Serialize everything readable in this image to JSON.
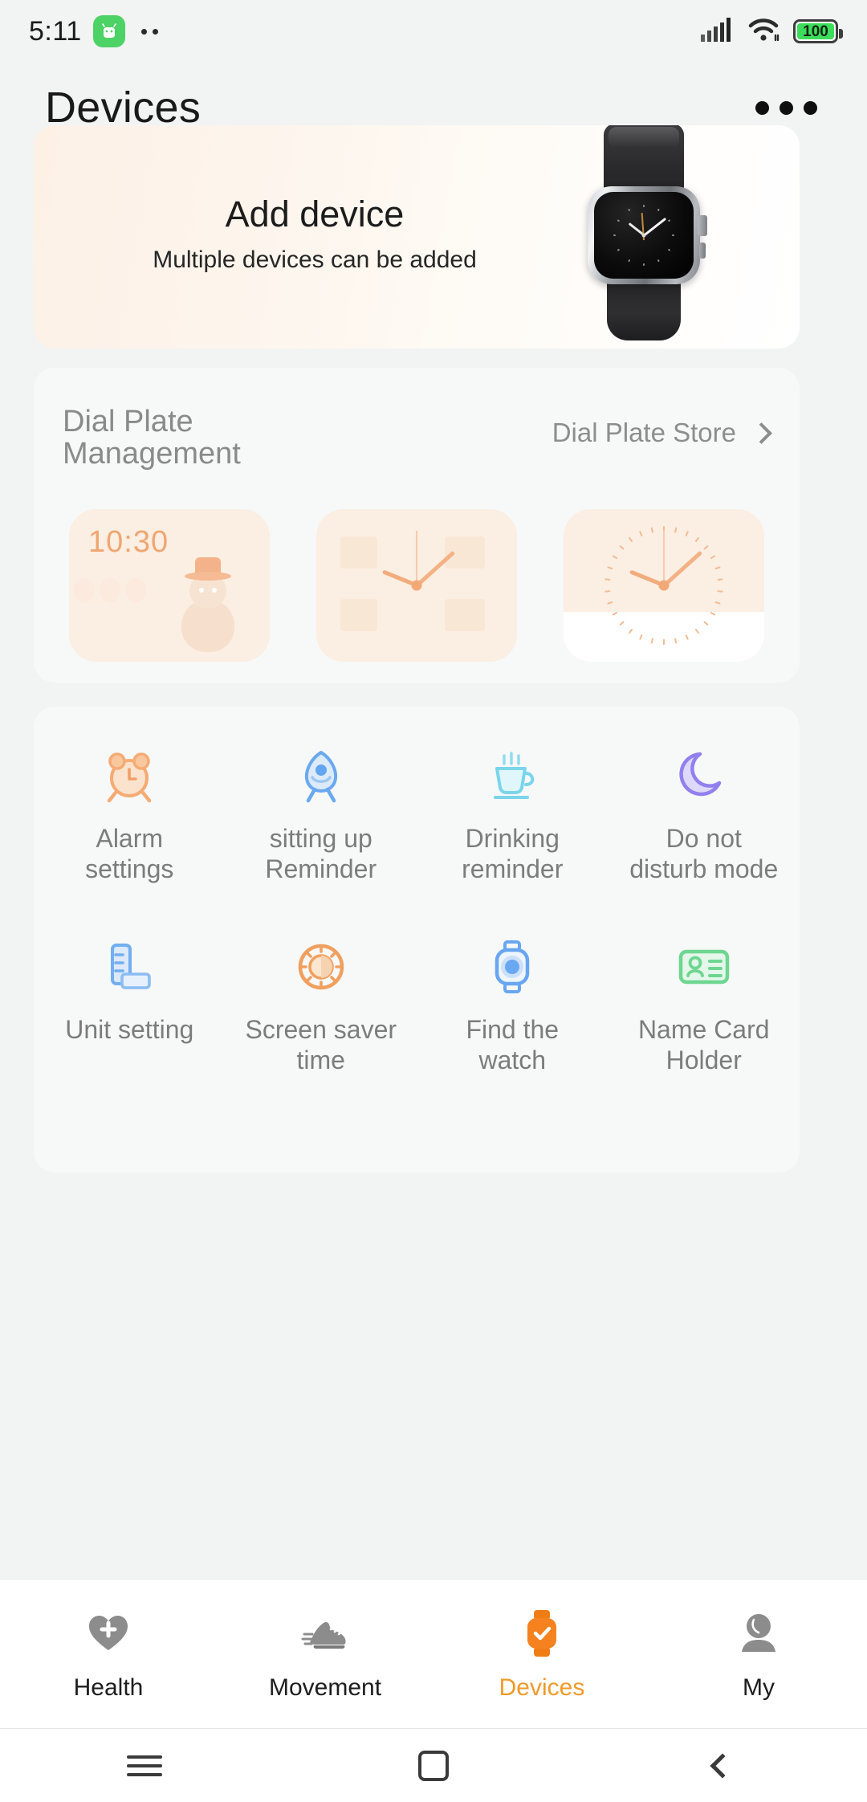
{
  "status_bar": {
    "time": "5:11",
    "badge_icon": "android-app-icon",
    "dots_icon": "notification-dots-icon",
    "signal_icon": "cellular-signal-icon",
    "wifi_icon": "wifi-icon",
    "battery_icon": "battery-icon",
    "battery_level": "100"
  },
  "header": {
    "title": "Devices",
    "more_icon": "more-options-icon"
  },
  "add_device": {
    "title": "Add device",
    "subtitle": "Multiple devices can be added",
    "image_icon": "smartwatch-product-image"
  },
  "dial_plate": {
    "title": "Dial Plate Management",
    "store_label": "Dial Plate Store",
    "store_chevron_icon": "chevron-right-icon",
    "thumbnails": [
      {
        "name": "snowman-dial",
        "time": "10:30"
      },
      {
        "name": "analog-numbers-dial",
        "time": ""
      },
      {
        "name": "analog-ticks-dial",
        "time": ""
      }
    ]
  },
  "functions": [
    {
      "label": "Alarm settings",
      "icon": "alarm-clock-icon",
      "color": "#f5ad78"
    },
    {
      "label": "sitting up Reminder",
      "icon": "sitting-up-icon",
      "color": "#66a8f0"
    },
    {
      "label": "Drinking reminder",
      "icon": "teacup-icon",
      "color": "#7fd9ea"
    },
    {
      "label": "Do not disturb mode",
      "icon": "crescent-moon-icon",
      "color": "#9f8ef0"
    },
    {
      "label": "Unit setting",
      "icon": "ruler-icon",
      "color": "#7fb2ef"
    },
    {
      "label": "Screen saver time",
      "icon": "brightness-sun-icon",
      "color": "#f0a05f"
    },
    {
      "label": "Find the watch",
      "icon": "find-watch-icon",
      "color": "#62a4f2"
    },
    {
      "label": "Name Card Holder",
      "icon": "name-card-icon",
      "color": "#6ed690"
    }
  ],
  "tabs": [
    {
      "label": "Health",
      "icon": "heart-plus-icon",
      "active": false
    },
    {
      "label": "Movement",
      "icon": "sneaker-icon",
      "active": false
    },
    {
      "label": "Devices",
      "icon": "watch-check-icon",
      "active": true
    },
    {
      "label": "My",
      "icon": "person-icon",
      "active": false
    }
  ],
  "system_nav": {
    "recents_icon": "menu-icon",
    "home_icon": "home-square-icon",
    "back_icon": "back-chevron-icon"
  },
  "colors": {
    "accent": "#ef9a2b",
    "page_bg": "#f2f3f3",
    "card_bg": "#f7f8f8",
    "muted_text": "#8a8a8a"
  }
}
